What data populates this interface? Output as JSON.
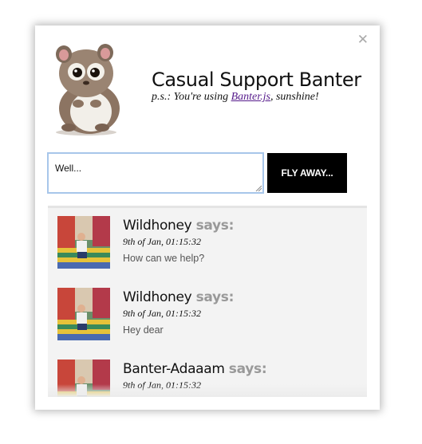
{
  "header": {
    "title": "Casual Support Banter",
    "subtitle_prefix": "p.s.: You're using ",
    "subtitle_link": "Banter.js",
    "subtitle_suffix": ", sunshine!"
  },
  "compose": {
    "value": "Well...",
    "send_label": "FLY AWAY..."
  },
  "messages": [
    {
      "author": "Wildhoney",
      "says": "says:",
      "time": "9th of Jan, 01:15:32",
      "text": "How can we help?"
    },
    {
      "author": "Wildhoney",
      "says": "says:",
      "time": "9th of Jan, 01:15:32",
      "text": "Hey dear"
    },
    {
      "author": "Banter-Adaaam",
      "says": "says:",
      "time": "9th of Jan, 01:15:32",
      "text": ""
    }
  ],
  "icons": {
    "close": "close-icon",
    "mascot": "tarsier-mascot"
  },
  "colors": {
    "button_bg": "#000000",
    "says": "#999999",
    "link": "#551a8b",
    "input_focus": "#a7c6ea"
  }
}
